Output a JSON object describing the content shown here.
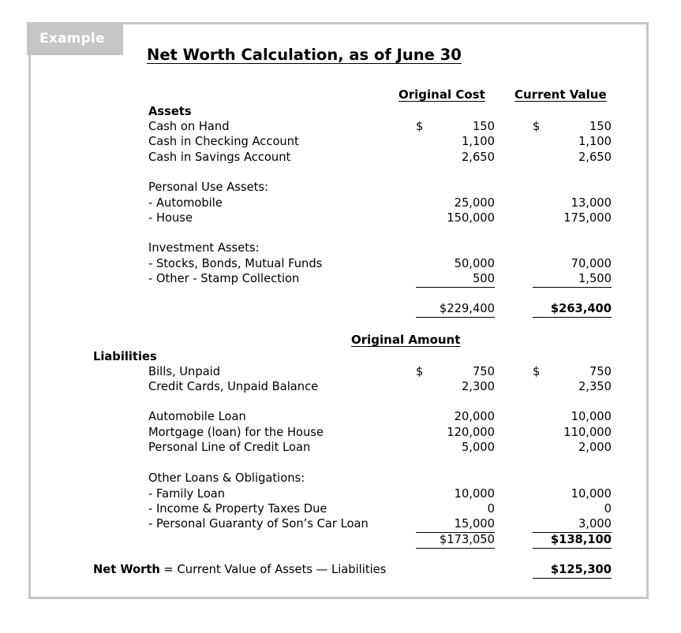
{
  "tab": {
    "label": "Example"
  },
  "title": "Net Worth Calculation, as of June 30",
  "headers": {
    "original_cost": "Original Cost",
    "current_value": "Current Value",
    "original_amount": "Original Amount"
  },
  "assets": {
    "heading": "Assets",
    "cash_rows": [
      {
        "label": "Cash on Hand",
        "cost_cur": "$",
        "cost": "150",
        "value_cur": "$",
        "value": "150"
      },
      {
        "label": "Cash in Checking Account",
        "cost_cur": "",
        "cost": "1,100",
        "value_cur": "",
        "value": "1,100"
      },
      {
        "label": "Cash in Savings Account",
        "cost_cur": "",
        "cost": "2,650",
        "value_cur": "",
        "value": "2,650"
      }
    ],
    "personal_heading": "Personal Use Assets:",
    "personal_rows": [
      {
        "label": "- Automobile",
        "cost": "25,000",
        "value": "13,000"
      },
      {
        "label": "- House",
        "cost": "150,000",
        "value": "175,000"
      }
    ],
    "investment_heading": "Investment Assets:",
    "investment_rows": [
      {
        "label": "- Stocks, Bonds, Mutual Funds",
        "cost": "50,000",
        "value": "70,000"
      },
      {
        "label": "- Other - Stamp Collection",
        "cost": "500",
        "value": "1,500"
      }
    ],
    "total_cost": "$229,400",
    "total_value": "$263,400"
  },
  "liabilities": {
    "heading": "Liabilities",
    "bills_rows": [
      {
        "label": "Bills, Unpaid",
        "cost_cur": "$",
        "cost": "750",
        "value_cur": "$",
        "value": "750"
      },
      {
        "label": "Credit Cards, Unpaid Balance",
        "cost_cur": "",
        "cost": "2,300",
        "value_cur": "",
        "value": "2,350"
      }
    ],
    "loan_rows": [
      {
        "label": "Automobile Loan",
        "cost": "20,000",
        "value": "10,000"
      },
      {
        "label": "Mortgage (loan) for the House",
        "cost": "120,000",
        "value": "110,000"
      },
      {
        "label": "Personal Line of Credit Loan",
        "cost": "5,000",
        "value": "2,000"
      }
    ],
    "other_heading": "Other Loans & Obligations:",
    "other_rows": [
      {
        "label": "- Family Loan",
        "cost": "10,000",
        "value": "10,000"
      },
      {
        "label": "- Income & Property Taxes Due",
        "cost": "0",
        "value": "0"
      },
      {
        "label": "- Personal Guaranty of Son’s Car Loan",
        "cost": "15,000",
        "value": "3,000"
      }
    ],
    "total_cost": "$173,050",
    "total_value": "$138,100"
  },
  "net_worth": {
    "label_bold": "Net Worth",
    "label_rest": " = Current Value of Assets — Liabilities",
    "value": "$125,300"
  },
  "colors": {
    "frame": "#c6c6c6",
    "tab_bg": "#c6c6c6",
    "tab_text": "#ffffff",
    "text": "#000000",
    "page_bg": "#ffffff"
  }
}
